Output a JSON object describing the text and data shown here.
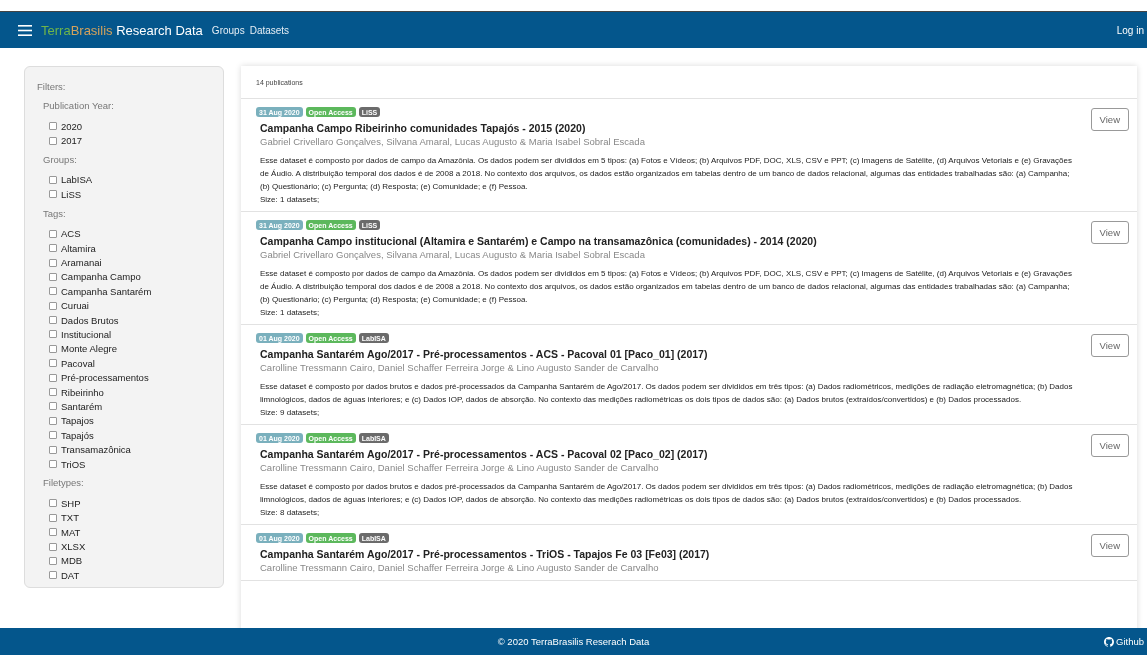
{
  "navbar": {
    "brand": {
      "part_1": "Terra",
      "part_2": "Brasilis",
      "part_3": "Research Data"
    },
    "links": [
      "Groups",
      "Datasets"
    ],
    "login": "Log in"
  },
  "filters": {
    "title": "Filters:",
    "sections": [
      {
        "heading": "Publication Year:",
        "options": [
          {
            "label": "2020",
            "checked": false
          },
          {
            "label": "2017",
            "checked": false
          }
        ]
      },
      {
        "heading": "Groups:",
        "options": [
          {
            "label": "LabISA",
            "checked": false
          },
          {
            "label": "LiSS",
            "checked": false
          }
        ]
      },
      {
        "heading": "Tags:",
        "options": [
          {
            "label": "ACS",
            "checked": false
          },
          {
            "label": "Altamira",
            "checked": false
          },
          {
            "label": "Aramanai",
            "checked": false
          },
          {
            "label": "Campanha Campo",
            "checked": false
          },
          {
            "label": "Campanha Santarém",
            "checked": false
          },
          {
            "label": "Curuai",
            "checked": false
          },
          {
            "label": "Dados Brutos",
            "checked": false
          },
          {
            "label": "Institucional",
            "checked": false
          },
          {
            "label": "Monte Alegre",
            "checked": false
          },
          {
            "label": "Pacoval",
            "checked": false
          },
          {
            "label": "Pré-processamentos",
            "checked": false
          },
          {
            "label": "Ribeirinho",
            "checked": false
          },
          {
            "label": "Santarém",
            "checked": false
          },
          {
            "label": "Tapajos",
            "checked": false
          },
          {
            "label": "Tapajós",
            "checked": false
          },
          {
            "label": "Transamazônica",
            "checked": false
          },
          {
            "label": "TriOS",
            "checked": false
          }
        ]
      },
      {
        "heading": "Filetypes:",
        "options": [
          {
            "label": "SHP",
            "checked": false
          },
          {
            "label": "TXT",
            "checked": false
          },
          {
            "label": "MAT",
            "checked": false
          },
          {
            "label": "XLSX",
            "checked": false
          },
          {
            "label": "MDB",
            "checked": false
          },
          {
            "label": "DAT",
            "checked": false
          }
        ]
      }
    ]
  },
  "results": {
    "count": "14 publications",
    "items": [
      {
        "badges": [
          {
            "kind": "date",
            "text": "31 Aug 2020"
          },
          {
            "kind": "access",
            "text": "Open Access"
          },
          {
            "kind": "group",
            "text": "LiSS"
          }
        ],
        "title": "Campanha Campo Ribeirinho comunidades Tapajós - 2015 (2020)",
        "authors": "Gabriel Crivellaro Gonçalves, Silvana Amaral, Lucas Augusto & Maria Isabel Sobral Escada",
        "description": "Esse dataset é composto por dados de campo da Amazônia. Os dados podem ser divididos em 5 tipos: (a) Fotos e Vídeos; (b) Arquivos PDF, DOC, XLS, CSV e PPT; (c) Imagens de Satélite, (d) Arquivos Vetoriais e (e) Gravações de Áudio. A distribuição temporal dos dados é de 2008 a 2018. No contexto dos arquivos, os dados estão organizados em tabelas dentro de um banco de dados relacional, algumas das entidades trabalhadas são: (a) Campanha; (b) Questionário; (c) Pergunta; (d) Resposta; (e) Comunidade; e (f) Pessoa.",
        "size": "Size: 1 datasets;",
        "button": "View"
      },
      {
        "badges": [
          {
            "kind": "date",
            "text": "31 Aug 2020"
          },
          {
            "kind": "access",
            "text": "Open Access"
          },
          {
            "kind": "group",
            "text": "LiSS"
          }
        ],
        "title": "Campanha Campo institucional (Altamira e Santarém) e Campo na transamazônica (comunidades) - 2014 (2020)",
        "authors": "Gabriel Crivellaro Gonçalves, Silvana Amaral, Lucas Augusto & Maria Isabel Sobral Escada",
        "description": "Esse dataset é composto por dados de campo da Amazônia. Os dados podem ser divididos em 5 tipos: (a) Fotos e Vídeos; (b) Arquivos PDF, DOC, XLS, CSV e PPT; (c) Imagens de Satélite, (d) Arquivos Vetoriais e (e) Gravações de Áudio. A distribuição temporal dos dados é de 2008 a 2018. No contexto dos arquivos, os dados estão organizados em tabelas dentro de um banco de dados relacional, algumas das entidades trabalhadas são: (a) Campanha; (b) Questionário; (c) Pergunta; (d) Resposta; (e) Comunidade; e (f) Pessoa.",
        "size": "Size: 1 datasets;",
        "button": "View"
      },
      {
        "badges": [
          {
            "kind": "date",
            "text": "01 Aug 2020"
          },
          {
            "kind": "access",
            "text": "Open Access"
          },
          {
            "kind": "group",
            "text": "LabISA"
          }
        ],
        "title": "Campanha Santarém Ago/2017 - Pré-processamentos - ACS - Pacoval 01 [Paco_01] (2017)",
        "authors": "Carolline Tressmann Cairo, Daniel Schaffer Ferreira Jorge & Lino Augusto Sander de Carvalho",
        "description": "Esse dataset é composto por dados brutos e dados pré-processados da Campanha Santarém de Ago/2017. Os dados podem ser divididos em três tipos: (a) Dados radiométricos, medições de radiação eletromagnética; (b) Dados limnológicos, dados de águas interiores; e (c) Dados IOP, dados de absorção. No contexto das medições radiométricas os dois tipos de dados são: (a) Dados brutos (extraídos/convertidos) e (b) Dados processados.",
        "size": "Size: 9 datasets;",
        "button": "View"
      },
      {
        "badges": [
          {
            "kind": "date",
            "text": "01 Aug 2020"
          },
          {
            "kind": "access",
            "text": "Open Access"
          },
          {
            "kind": "group",
            "text": "LabISA"
          }
        ],
        "title": "Campanha Santarém Ago/2017 - Pré-processamentos - ACS - Pacoval 02 [Paco_02] (2017)",
        "authors": "Carolline Tressmann Cairo, Daniel Schaffer Ferreira Jorge & Lino Augusto Sander de Carvalho",
        "description": "Esse dataset é composto por dados brutos e dados pré-processados da Campanha Santarém de Ago/2017. Os dados podem ser divididos em três tipos: (a) Dados radiométricos, medições de radiação eletromagnética; (b) Dados limnológicos, dados de águas interiores; e (c) Dados IOP, dados de absorção. No contexto das medições radiométricas os dois tipos de dados são: (a) Dados brutos (extraídos/convertidos) e (b) Dados processados.",
        "size": "Size: 8 datasets;",
        "button": "View"
      },
      {
        "badges": [
          {
            "kind": "date",
            "text": "01 Aug 2020"
          },
          {
            "kind": "access",
            "text": "Open Access"
          },
          {
            "kind": "group",
            "text": "LabISA"
          }
        ],
        "title": "Campanha Santarém Ago/2017 - Pré-processamentos - TriOS - Tapajos Fe 03 [Fe03] (2017)",
        "authors": "Carolline Tressmann Cairo, Daniel Schaffer Ferreira Jorge & Lino Augusto Sander de Carvalho",
        "button": "View"
      }
    ]
  },
  "footer": {
    "copyright": "© 2020 TerraBrasilis Reserach Data",
    "github": "Github"
  }
}
